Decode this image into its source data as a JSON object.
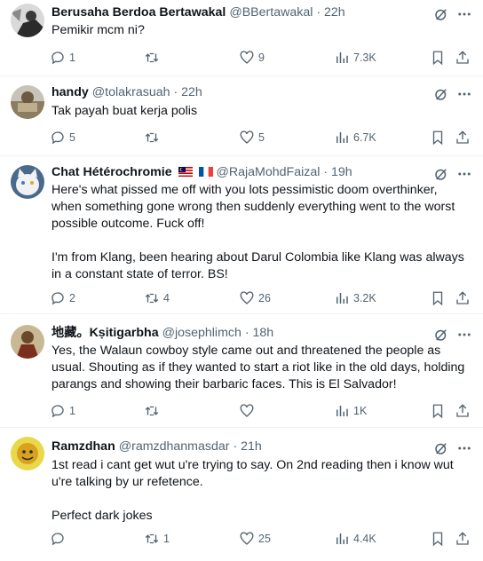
{
  "tweets": [
    {
      "name": "Berusaha Berdoa Bertawakal",
      "handle": "@BBertawakal",
      "time": "22h",
      "text": "Pemikir mcm ni?",
      "replies": "1",
      "reposts": "",
      "likes": "9",
      "views": "7.3K"
    },
    {
      "name": "handy",
      "handle": "@tolakrasuah",
      "time": "22h",
      "text": "Tak payah buat kerja polis",
      "replies": "5",
      "reposts": "",
      "likes": "5",
      "views": "6.7K"
    },
    {
      "name": "Chat Hétérochromie",
      "handle": "@RajaMohdFaizal",
      "time": "19h",
      "text": "Here's what pissed me off with you lots pessimistic doom overthinker, when something gone wrong then suddenly everything went to the worst possible outcome. Fuck off!\n\nI'm from Klang, been hearing about Darul Colombia like Klang was always in a constant state of terror. BS!",
      "replies": "2",
      "reposts": "4",
      "likes": "26",
      "views": "3.2K"
    },
    {
      "name": "地藏。Kṣitigarbha",
      "handle": "@josephlimch",
      "time": "18h",
      "text": "Yes, the Walaun cowboy style came out and threatened the people as usual. Shouting as if they wanted to start a riot like in the old days, holding parangs and showing their barbaric faces. This is El Salvador!",
      "replies": "1",
      "reposts": "",
      "likes": "",
      "views": "1K"
    },
    {
      "name": "Ramzdhan",
      "handle": "@ramzdhanmasdar",
      "time": "21h",
      "text": "1st read i cant get wut u're trying to say. On 2nd reading then i know wut u're talking by ur refetence.\n\nPerfect dark jokes",
      "replies": "",
      "reposts": "1",
      "likes": "25",
      "views": "4.4K"
    }
  ],
  "colors": {
    "text": "#0f1419",
    "secondary": "#536471",
    "border": "#eff3f4"
  }
}
